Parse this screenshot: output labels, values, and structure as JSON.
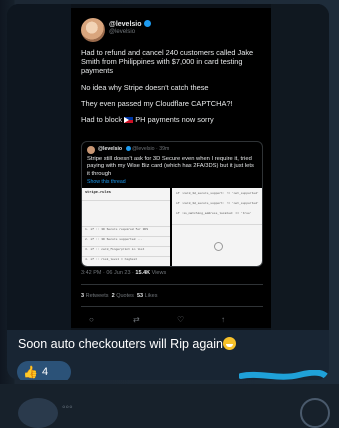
{
  "tweet": {
    "name": "@levelsio",
    "handle": "@levelsio",
    "paragraphs": [
      "Had to refund and cancel 240 customers called Jake Smith from Philippines with $7,000 in card testing payments",
      "No idea why Stripe doesn't catch these",
      "They even passed my Cloudflare CAPTCHA?!"
    ],
    "block_line_prefix": "Had to block",
    "block_line_suffix": "PH payments now sorry",
    "quote": {
      "name": "@levelsio",
      "handle": "@levelsio",
      "time": "39m",
      "text": "Stripe still doesn't ask for 3D Secure even when I require it, tried paying with my Wise Biz card (which has 2FA/3DS) but it just lets it through",
      "show_more": "Show this thread",
      "img1_header": "stripe-rules",
      "img1_rows": [
        "1. if :: 3D Secure required for 3DS",
        "2. if :: 3D Secure supported ...",
        "3. if :: card_fingerprint in list",
        "4. if :: risk_level = highest"
      ],
      "img2_rows": [
        "if :card_3d_secure_support: != 'not_supported'",
        "if :card_3d_secure_support: != 'not_supported'",
        "if :is_matching_address_located: == 'true'"
      ]
    },
    "time": "3:42 PM · 06 Jun 23 ·",
    "views": "15.4K",
    "views_label": "Views",
    "retweets": "3",
    "retweets_label": "Retweets",
    "quotes": "2",
    "quotes_label": "Quotes",
    "likes": "53",
    "likes_label": "Likes"
  },
  "message": {
    "caption": "Soon auto checkouters will Rip again",
    "reaction_emoji": "👍",
    "reaction_count": "4"
  },
  "icons": [
    "verified-badge-icon",
    "thumbs-up-icon",
    "grinning-sweat-emoji-icon",
    "reply-icon",
    "retweet-icon",
    "like-icon",
    "share-icon"
  ],
  "colors": {
    "chat_bg": "#17212b",
    "bubble_bg": "#182533",
    "reaction_bg": "#2b5278",
    "twitter_blue": "#1d9bf0",
    "scribble": "#1fa1d8"
  }
}
